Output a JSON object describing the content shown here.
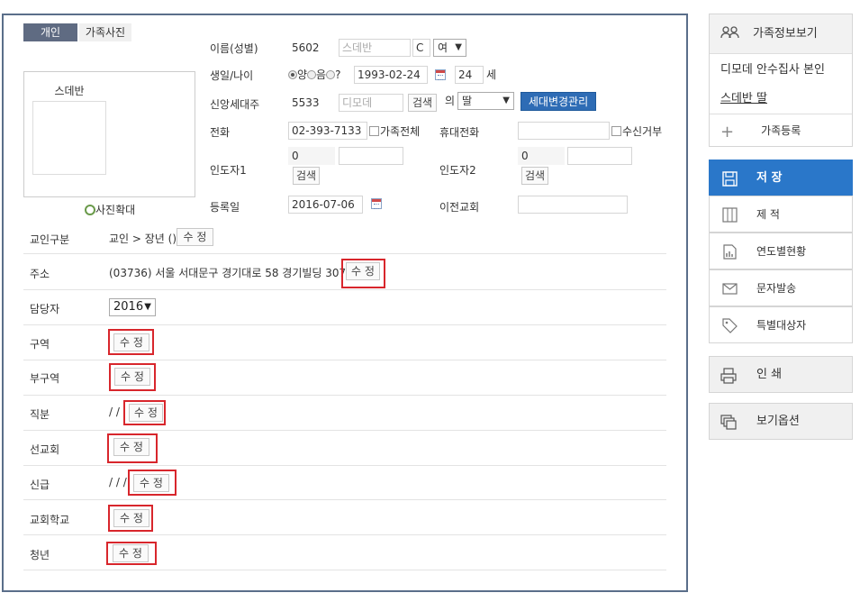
{
  "tabs": {
    "personal": "개인",
    "family_photo": "가족사진"
  },
  "photo": {
    "name": "스데반",
    "zoom_label": "사진확대"
  },
  "form": {
    "name_label": "이름(성별)",
    "name_id": "5602",
    "name_value": "스데반",
    "name_code": "C",
    "gender": "여",
    "birth_label": "생일/나이",
    "lunar_solar_1": "양",
    "lunar_solar_2": "음",
    "lunar_solar_3": "?",
    "birth_date": "1993-02-24",
    "age": "24",
    "age_unit": "세",
    "head_label": "신앙세대주",
    "head_id": "5533",
    "head_name": "디모데",
    "search": "검색",
    "of": "의",
    "relation": "딸",
    "household_btn": "세대변경관리",
    "phone_label": "전화",
    "phone_value": "02-393-7133",
    "family_all": "가족전체",
    "mobile_label": "휴대전화",
    "mobile_value": "",
    "reject_label": "수신거부",
    "guide1_label": "인도자1",
    "guide1_id": "0",
    "guide1_name": "",
    "guide2_label": "인도자2",
    "guide2_id": "0",
    "guide2_name": "",
    "reg_label": "등록일",
    "reg_date": "2016-07-06",
    "prev_church_label": "이전교회",
    "prev_church_value": ""
  },
  "rows": {
    "member_type_label": "교인구분",
    "member_type_value": "교인 > 장년 ()",
    "address_label": "주소",
    "address_value": "(03736) 서울 서대문구 경기대로 58 경기빌딩 307호",
    "manager_label": "담당자",
    "manager_value": "2016",
    "district_label": "구역",
    "sub_district_label": "부구역",
    "position_label": "직분",
    "position_value": "/ /",
    "mission_label": "선교회",
    "grade_label": "신급",
    "grade_value": "/ / /",
    "school_label": "교회학교",
    "youth_label": "청년",
    "edit": "수 정"
  },
  "side": {
    "family_view": "가족정보보기",
    "family_line1": "디모데 안수집사 본인",
    "family_line2": "스데반 딸",
    "family_add": "가족등록",
    "save": "저 장",
    "delete": "제 적",
    "yearly": "연도별현황",
    "sms": "문자발송",
    "special": "특별대상자",
    "print": "인 쇄",
    "view_options": "보기옵션"
  },
  "colors": {
    "primary": "#2a77c9",
    "border": "#5a6e8a",
    "highlight": "#d8262c"
  }
}
